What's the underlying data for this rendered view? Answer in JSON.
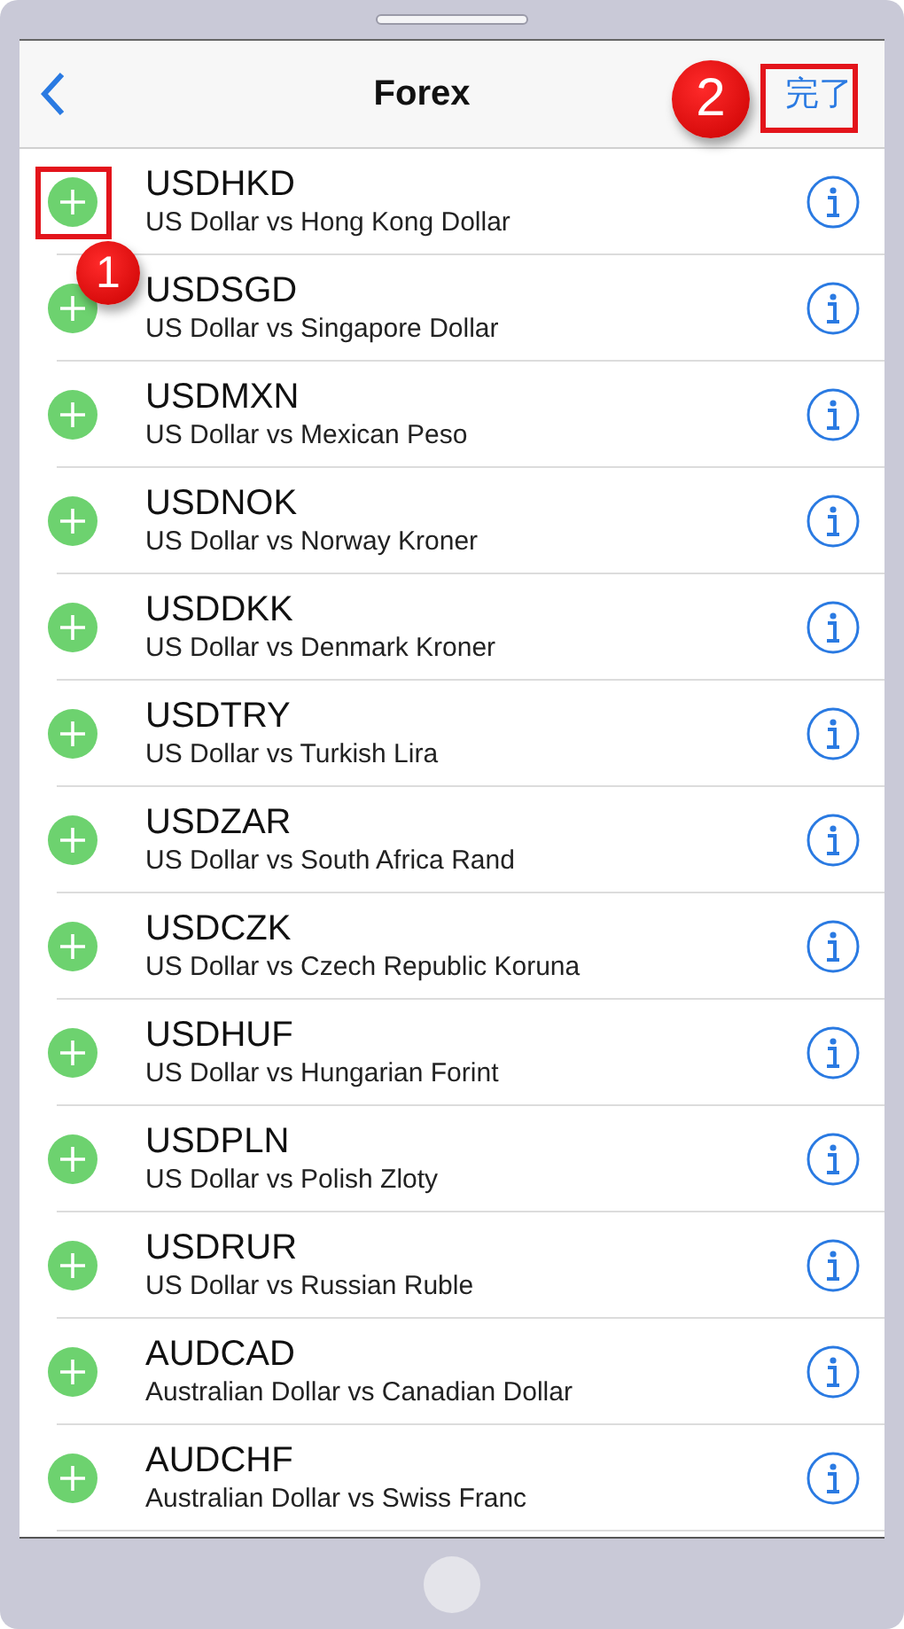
{
  "nav": {
    "title": "Forex",
    "done": "完了"
  },
  "pairs": [
    {
      "symbol": "USDHKD",
      "name": "US Dollar vs Hong Kong Dollar"
    },
    {
      "symbol": "USDSGD",
      "name": "US Dollar vs Singapore Dollar"
    },
    {
      "symbol": "USDMXN",
      "name": "US Dollar vs Mexican Peso"
    },
    {
      "symbol": "USDNOK",
      "name": "US Dollar vs Norway Kroner"
    },
    {
      "symbol": "USDDKK",
      "name": "US Dollar vs Denmark Kroner"
    },
    {
      "symbol": "USDTRY",
      "name": "US Dollar vs Turkish Lira"
    },
    {
      "symbol": "USDZAR",
      "name": "US Dollar vs South Africa Rand"
    },
    {
      "symbol": "USDCZK",
      "name": "US Dollar vs Czech Republic Koruna"
    },
    {
      "symbol": "USDHUF",
      "name": "US Dollar vs Hungarian Forint"
    },
    {
      "symbol": "USDPLN",
      "name": "US Dollar vs Polish Zloty"
    },
    {
      "symbol": "USDRUR",
      "name": "US Dollar vs Russian Ruble"
    },
    {
      "symbol": "AUDCAD",
      "name": "Australian Dollar vs Canadian Dollar"
    },
    {
      "symbol": "AUDCHF",
      "name": "Australian Dollar vs Swiss Franc"
    }
  ],
  "callouts": [
    {
      "label": "1"
    },
    {
      "label": "2"
    }
  ]
}
